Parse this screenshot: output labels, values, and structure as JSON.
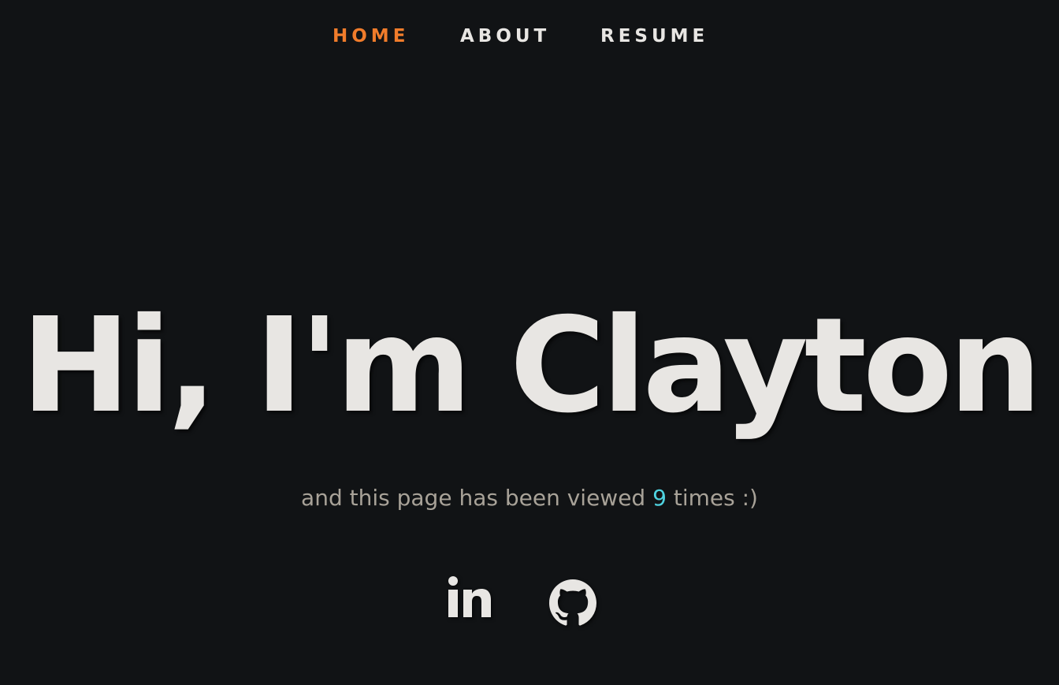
{
  "nav": {
    "items": [
      {
        "label": "HOME",
        "active": true
      },
      {
        "label": "ABOUT",
        "active": false
      },
      {
        "label": "RESUME",
        "active": false
      }
    ]
  },
  "hero": {
    "title": "Hi, I'm Clayton"
  },
  "subtitle": {
    "prefix": "and this page has been viewed",
    "count": "9",
    "suffix": "times :)"
  },
  "social": {
    "items": [
      {
        "icon": "linkedin-icon"
      },
      {
        "icon": "github-icon"
      }
    ]
  },
  "colors": {
    "background": "#111315",
    "text": "#e8e6e3",
    "accent": "#f07c2b",
    "count": "#4fd3e0",
    "muted": "#a8a298"
  }
}
